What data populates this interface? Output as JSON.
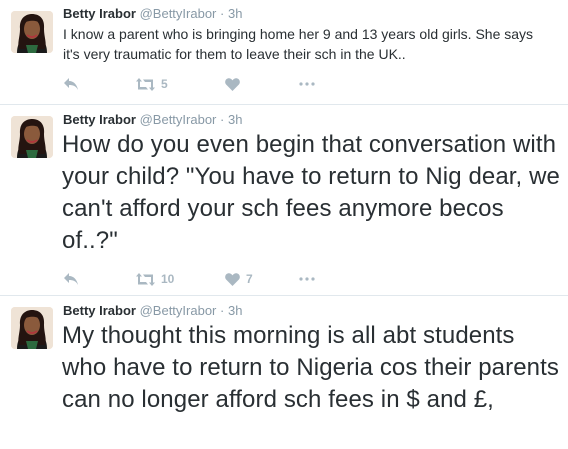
{
  "tweets": [
    {
      "fullname": "Betty Irabor",
      "username": "@BettyIrabor",
      "separator": "·",
      "time": "3h",
      "text": "I know a parent who is bringing home her 9 and 13 years old girls. She says it's very traumatic for them to leave their sch in the UK..",
      "retweet_count": "5",
      "like_count": ""
    },
    {
      "fullname": "Betty Irabor",
      "username": "@BettyIrabor",
      "separator": "·",
      "time": "3h",
      "text": "How do you even begin that conversation with your child? \"You have to return to Nig dear, we can't afford your sch fees anymore becos of..?\"",
      "retweet_count": "10",
      "like_count": "7"
    },
    {
      "fullname": "Betty Irabor",
      "username": "@BettyIrabor",
      "separator": "·",
      "time": "3h",
      "text": "My thought this morning is all abt students who have to return to Nigeria cos their parents can no longer afford sch fees in $ and £,"
    }
  ],
  "icons": {
    "reply": "reply-arrow-icon",
    "retweet": "retweet-icon",
    "like": "heart-icon",
    "more": "more-dots-icon"
  },
  "colors": {
    "text": "#292f33",
    "muted": "#8899a6",
    "action": "#aab8c2",
    "divider": "#e1e8ed"
  }
}
